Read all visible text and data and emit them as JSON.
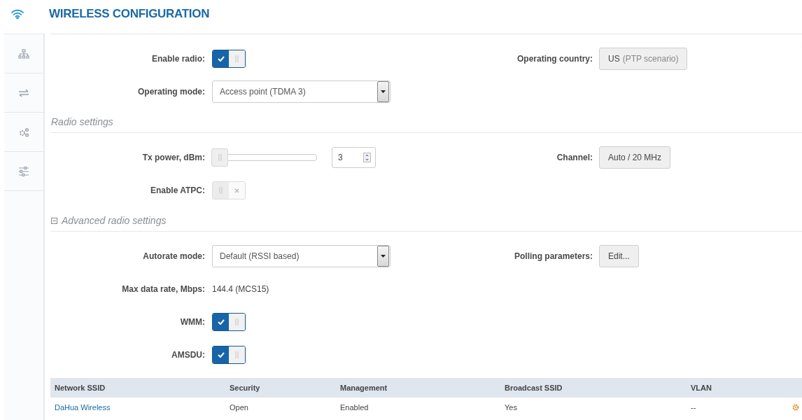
{
  "title": "WIRELESS CONFIGURATION",
  "sections": [
    {
      "rows": [
        {
          "kind": "toggle",
          "label": "Enable radio:",
          "on": true,
          "right": {
            "kind": "button",
            "label": "Operating country:",
            "value": "US",
            "detail": "(PTP scenario)"
          }
        },
        {
          "kind": "select",
          "label": "Operating mode:",
          "value": "Access point (TDMA 3)"
        }
      ]
    },
    {
      "heading": "Radio settings",
      "rows": [
        {
          "kind": "slider",
          "label": "Tx power, dBm:",
          "level": 0,
          "value": "3",
          "right": {
            "kind": "button",
            "label": "Channel:",
            "value": "Auto / 20 MHz"
          }
        },
        {
          "kind": "toggle",
          "label": "Enable ATPC:",
          "on": false
        }
      ]
    },
    {
      "heading": "Advanced radio settings",
      "expanded": true,
      "rows": [
        {
          "kind": "select",
          "label": "Autorate mode:",
          "value": "Default (RSSI based)",
          "right": {
            "kind": "button",
            "label": "Polling parameters:",
            "value": "Edit..."
          }
        },
        {
          "kind": "text",
          "label": "Max data rate, Mbps:",
          "value": "144.4 (MCS15)"
        },
        {
          "kind": "toggle",
          "label": "WMM:",
          "on": true
        },
        {
          "kind": "toggle",
          "label": "AMSDU:",
          "on": true
        }
      ]
    }
  ],
  "table": {
    "columns": [
      "Network SSID",
      "Security",
      "Management",
      "Broadcast SSID",
      "VLAN"
    ],
    "rows": [
      {
        "cells": [
          "DaHua Wireless",
          "Open",
          "Enabled",
          "Yes",
          "--"
        ]
      }
    ]
  }
}
